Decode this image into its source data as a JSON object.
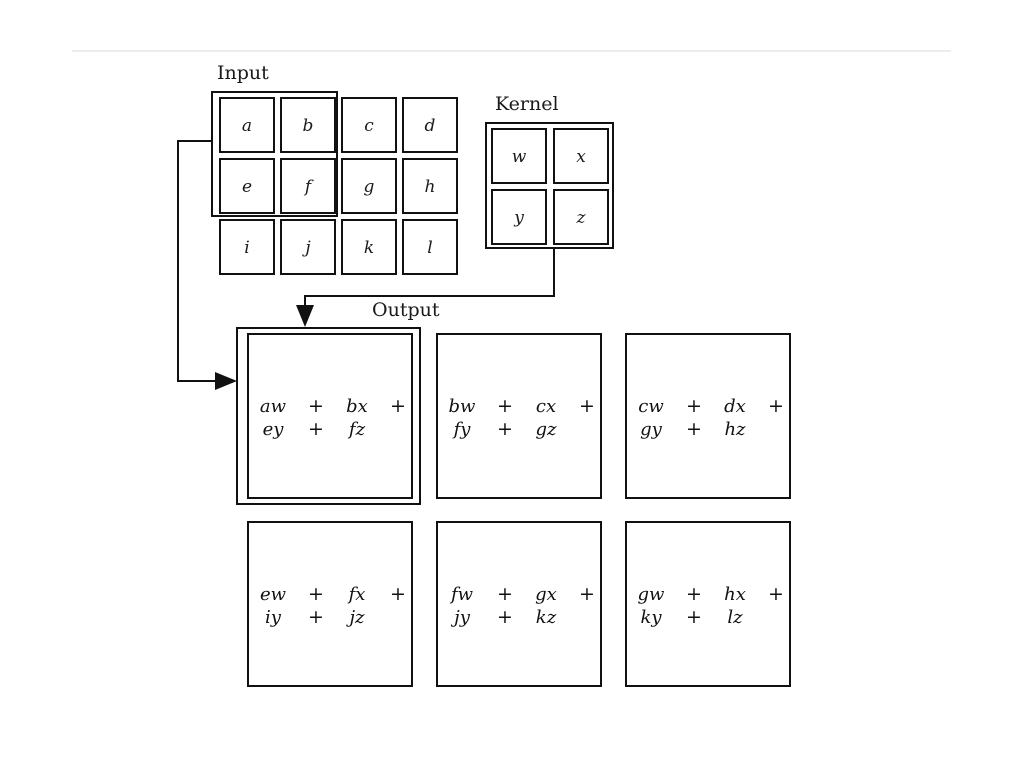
{
  "input": {
    "title": "Input",
    "cells": [
      [
        "a",
        "b",
        "c",
        "d"
      ],
      [
        "e",
        "f",
        "g",
        "h"
      ],
      [
        "i",
        "j",
        "k",
        "l"
      ]
    ]
  },
  "kernel": {
    "title": "Kernel",
    "cells": [
      [
        "w",
        "x"
      ],
      [
        "y",
        "z"
      ]
    ]
  },
  "output": {
    "title": "Output",
    "plus": "+",
    "cells": [
      [
        {
          "terms": [
            "aw",
            "bx",
            "ey",
            "fz"
          ]
        },
        {
          "terms": [
            "bw",
            "cx",
            "fy",
            "gz"
          ]
        },
        {
          "terms": [
            "cw",
            "dx",
            "gy",
            "hz"
          ]
        }
      ],
      [
        {
          "terms": [
            "ew",
            "fx",
            "iy",
            "jz"
          ]
        },
        {
          "terms": [
            "fw",
            "gx",
            "jy",
            "kz"
          ]
        },
        {
          "terms": [
            "gw",
            "hx",
            "ky",
            "lz"
          ]
        }
      ]
    ]
  }
}
